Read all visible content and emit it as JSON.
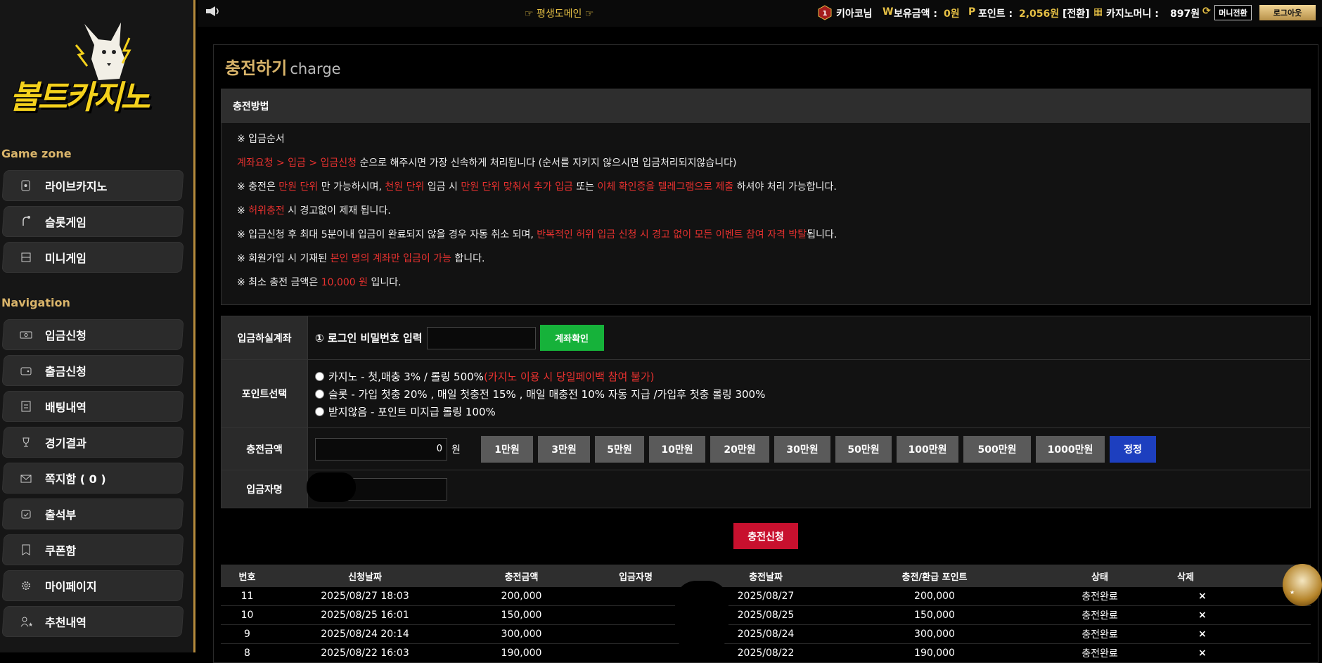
{
  "sidebar": {
    "brand": "볼트카지노",
    "game_zone_title": "Game zone",
    "game_items": [
      {
        "label": "라이브카지노",
        "icon": "card-icon"
      },
      {
        "label": "슬롯게임",
        "icon": "slot-icon"
      },
      {
        "label": "미니게임",
        "icon": "mini-game-icon"
      }
    ],
    "navigation_title": "Navigation",
    "nav_items": [
      {
        "label": "입금신청",
        "icon": "money-icon"
      },
      {
        "label": "출금신청",
        "icon": "wallet-icon"
      },
      {
        "label": "배팅내역",
        "icon": "history-icon"
      },
      {
        "label": "경기결과",
        "icon": "trophy-icon"
      },
      {
        "label": "쪽지함 ( 0 )",
        "icon": "mail-icon"
      },
      {
        "label": "출석부",
        "icon": "calendar-icon"
      },
      {
        "label": "쿠폰함",
        "icon": "coupon-icon"
      },
      {
        "label": "마이페이지",
        "icon": "gear-icon"
      },
      {
        "label": "추천내역",
        "icon": "user-star-icon"
      }
    ]
  },
  "topbar": {
    "domain_notice": "☞ 평생도메인 ☞",
    "level_badge": "1",
    "username": "키아코님",
    "balance_label": "보유금액 :",
    "balance_value": "0원",
    "point_label": "포인트 :",
    "point_value": "2,056원",
    "point_convert": "[전환]",
    "casino_money_label": "카지노머니 :",
    "casino_money_value": "897원",
    "money_convert_button": "머니전환",
    "logout_button": "로그아웃"
  },
  "page": {
    "title": "충전하기",
    "subtitle": "charge"
  },
  "notice": {
    "header": "충전방법",
    "line1": "※ 입금순서",
    "line2_red": "계좌요청 > 입금 > 입금신청",
    "line2_rest": " 순으로 해주시면 가장 신속하게 처리됩니다 (순서를 지키지 않으시면 입금처리되지않습니다)",
    "line3": [
      "※ 충전은 ",
      "만원 단위",
      " 만 가능하시며, ",
      "천원 단위",
      " 입금 시 ",
      "만원 단위 맞춰서 추가 입금",
      " 또는 ",
      "이체 확인증을 텔레그램으로 제출",
      " 하셔야 처리 가능합니다."
    ],
    "line4": [
      "※ ",
      "허위충전",
      " 시 경고없이 제재 됩니다."
    ],
    "line5": [
      "※ 입금신청 후 최대 5분이내 입금이 완료되지 않을 경우 자동 취소 되며, ",
      "반복적인 허위 입금 신청 시 경고 없이 모든 이벤트 참여 자격 박탈",
      "됩니다."
    ],
    "line6": [
      "※ 회원가입 시 기재된 ",
      "본인 명의 계좌만 입금이 가능",
      " 합니다."
    ],
    "line7": [
      "※ 최소 충전 금액은 ",
      "10,000 원",
      " 입니다."
    ]
  },
  "form": {
    "account_label": "입금하실계좌",
    "password_prompt": "① 로그인 비밀번호 입력",
    "check_account_button": "계좌확인",
    "point_label": "포인트선택",
    "point_options": [
      {
        "text": "카지노 - 첫,매충 3% / 롤링 500% ",
        "note": "(카지노 이용 시 당일페이백 참여 불가)"
      },
      {
        "text": "슬롯 - 가입 첫충 20% , 매일 첫충전 15% , 매일 매충전 10% 자동 지급 /가입후 첫충 롤링 300%",
        "note": ""
      },
      {
        "text": "받지않음 - 포인트 미지급 롤링 100%",
        "note": ""
      }
    ],
    "amount_label": "충전금액",
    "amount_value": "0",
    "amount_unit": "원",
    "amount_buttons": [
      "1만원",
      "3만원",
      "5만원",
      "10만원",
      "20만원",
      "30만원",
      "50만원",
      "100만원",
      "500만원",
      "1000만원"
    ],
    "reset_button": "정정",
    "depositor_label": "입금자명",
    "submit_button": "충전신청"
  },
  "history": {
    "headers": [
      "번호",
      "신청날짜",
      "충전금액",
      "입금자명",
      "충전날짜",
      "충전/환급 포인트",
      "상태",
      "삭제"
    ],
    "rows": [
      [
        "11",
        "2025/08/27 18:03",
        "200,000",
        "",
        "2025/08/27",
        "200,000",
        "충전완료",
        "×"
      ],
      [
        "10",
        "2025/08/25 16:01",
        "150,000",
        "",
        "2025/08/25",
        "150,000",
        "충전완료",
        "×"
      ],
      [
        "9",
        "2025/08/24 20:14",
        "300,000",
        "",
        "2025/08/24",
        "300,000",
        "충전완료",
        "×"
      ],
      [
        "8",
        "2025/08/22 16:03",
        "190,000",
        "",
        "2025/08/22",
        "190,000",
        "충전완료",
        "×"
      ]
    ]
  },
  "colors": {
    "gold": "#d9b46a",
    "red": "#e8312f",
    "green": "#16b23a",
    "blue": "#1d3fbf",
    "submit": "#c8102e"
  }
}
